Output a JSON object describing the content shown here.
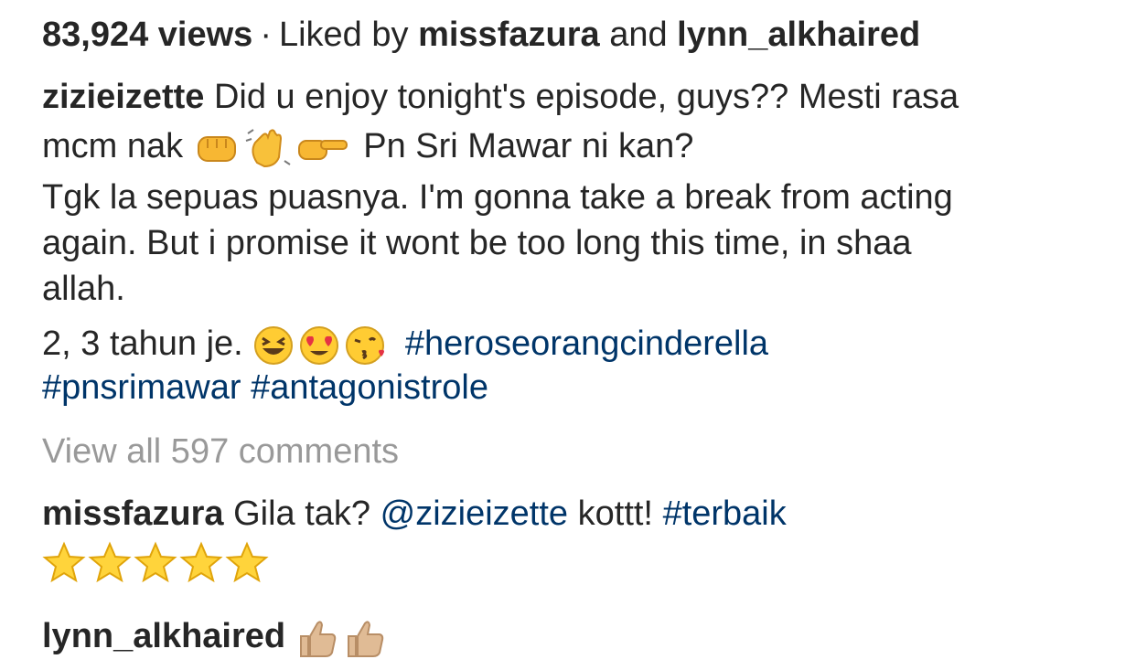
{
  "post": {
    "views": "83,924 views",
    "dot": "·",
    "liked_by_prefix": "Liked by",
    "liked_user_1": "missfazura",
    "and": "and",
    "liked_user_2": "lynn_alkhaired"
  },
  "caption": {
    "author": "zizieizette",
    "line1": "Did u enjoy tonight's episode, guys?? Mesti rasa",
    "line2_a": "mcm nak",
    "line2_emojis": [
      "fist-emoji",
      "waving-hand-emoji",
      "pointing-right-emoji"
    ],
    "line2_b": "Pn Sri Mawar ni kan?",
    "line3": "Tgk la sepuas puasnya. I'm gonna take a break from acting",
    "line4": "again. But i promise it wont be too long this time, in shaa",
    "line5": "allah.",
    "line6_a": "2, 3 tahun je.",
    "line6_emojis": [
      "grinning-squinting-face-emoji",
      "heart-eyes-face-emoji",
      "kissing-face-emoji"
    ],
    "hashtag1": "#heroseorangcinderella",
    "hashtag2": "#pnsrimawar",
    "hashtag3": "#antagonistrole"
  },
  "view_comments": "View all 597 comments",
  "comments": [
    {
      "user": "missfazura",
      "text_a": "Gila tak?",
      "mention": "@zizieizette",
      "text_b": "kottt!",
      "hashtag": "#terbaik",
      "emojis": [
        "star-emoji",
        "star-emoji",
        "star-emoji",
        "star-emoji",
        "star-emoji"
      ]
    },
    {
      "user": "lynn_alkhaired",
      "emojis": [
        "thumbs-up-emoji",
        "thumbs-up-emoji"
      ]
    }
  ],
  "colors": {
    "text": "#262626",
    "link": "#003569",
    "muted": "#999999",
    "emoji_yellow": "#FFCC33",
    "skin_tone": "#E0BB95"
  }
}
